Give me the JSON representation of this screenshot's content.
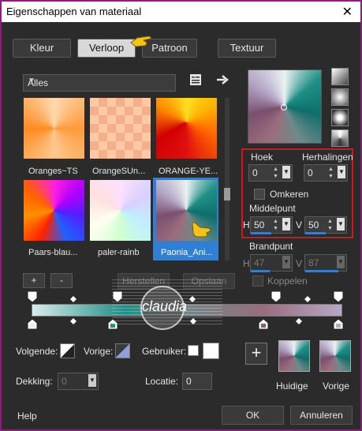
{
  "window": {
    "title": "Eigenschappen van materiaal",
    "close_glyph": "✕"
  },
  "tabs": [
    {
      "label": "Kleur"
    },
    {
      "label": "Verloop"
    },
    {
      "label": "Patroon"
    },
    {
      "label": "Textuur"
    }
  ],
  "library": {
    "filter": "Alles",
    "tiles": [
      {
        "label": "Oranges~TS"
      },
      {
        "label": "OrangeSUn..."
      },
      {
        "label": "ORANGE-YE..."
      },
      {
        "label": "Paars-blau..."
      },
      {
        "label": "paler-rainb"
      },
      {
        "label": "Paonia_Ani..."
      }
    ],
    "add_label": "+",
    "remove_label": "-",
    "reset_label": "Herstellen",
    "save_label": "Opslaan"
  },
  "settings": {
    "hoek_label": "Hoek",
    "hoek_value": "0",
    "herhalingen_label": "Herhalingen",
    "herhalingen_value": "0",
    "omkeren_label": "Omkeren",
    "middelpunt_label": "Middelpunt",
    "mid_h_label": "H",
    "mid_h_value": "50",
    "mid_v_label": "V",
    "mid_v_value": "50",
    "brandpunt_label": "Brandpunt",
    "brand_h_label": "H",
    "brand_h_value": "47",
    "brand_v_label": "V",
    "brand_v_value": "87",
    "koppelen_label": "Koppelen"
  },
  "editor": {
    "volgende_label": "Volgende:",
    "vorige_label": "Vorige:",
    "gebruiker_label": "Gebruiker:",
    "dekking_label": "Dekking:",
    "dekking_value": "0",
    "locatie_label": "Locatie:",
    "locatie_value": "0"
  },
  "swatches": {
    "huidige_label": "Huidige",
    "vorige_label": "Vorige",
    "add_label": "+"
  },
  "footer": {
    "help": "Help",
    "ok": "OK",
    "cancel": "Annuleren"
  },
  "watermark": {
    "text": "claudia"
  },
  "colors": {
    "accent_blue": "#2f7fd4",
    "highlight_red": "#d4161c",
    "frame": "#8a1f7a"
  }
}
